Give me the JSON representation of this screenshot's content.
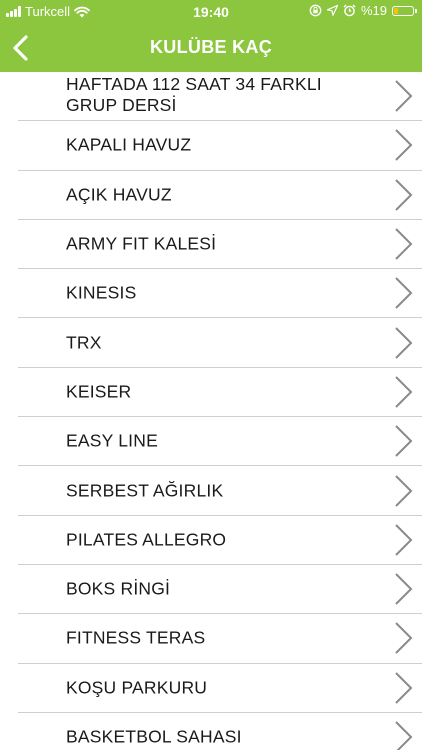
{
  "status_bar": {
    "carrier": "Turkcell",
    "time": "19:40",
    "battery": "%19"
  },
  "nav": {
    "title": "KULÜBE KAÇ"
  },
  "list": {
    "items": [
      {
        "label": "HAFTADA 112 SAAT 34 FARKLI GRUP DERSİ"
      },
      {
        "label": "KAPALI HAVUZ"
      },
      {
        "label": "AÇIK HAVUZ"
      },
      {
        "label": "ARMY FIT KALESİ"
      },
      {
        "label": "KINESIS"
      },
      {
        "label": "TRX"
      },
      {
        "label": "KEISER"
      },
      {
        "label": "EASY LINE"
      },
      {
        "label": "SERBEST AĞIRLIK"
      },
      {
        "label": "PILATES ALLEGRO"
      },
      {
        "label": "BOKS RİNGİ"
      },
      {
        "label": "FITNESS TERAS"
      },
      {
        "label": "KOŞU PARKURU"
      },
      {
        "label": "BASKETBOL SAHASI"
      }
    ]
  },
  "colors": {
    "header": "#8cc63f",
    "chevron": "#8a8a8a",
    "divider": "#cfcfcf",
    "text": "#1a1a1a"
  }
}
